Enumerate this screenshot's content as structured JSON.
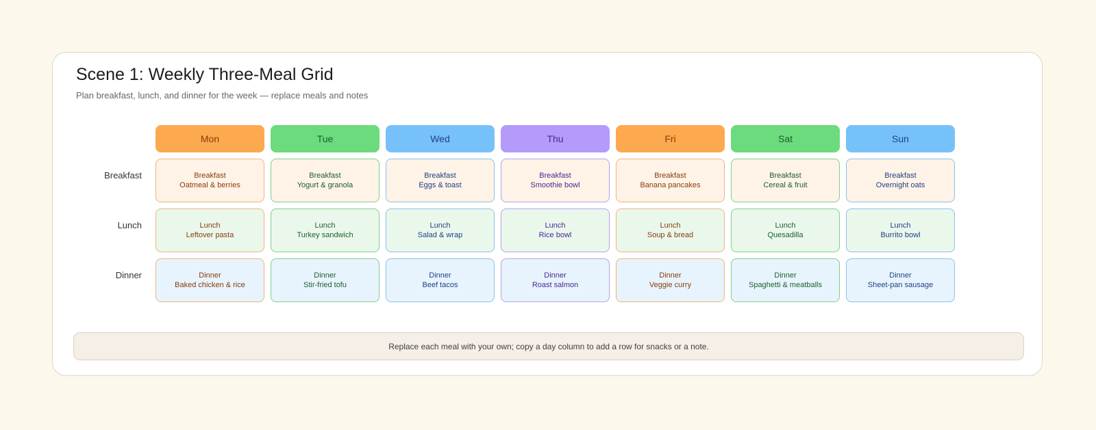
{
  "title": "Scene 1: Weekly Three-Meal Grid",
  "subtitle": "Plan breakfast, lunch, and dinner for the week — replace meals and notes",
  "days": [
    {
      "label": "Mon",
      "color": "#fda94f",
      "text_color": "#8a3a0c",
      "border": "#f0b47a"
    },
    {
      "label": "Tue",
      "color": "#6bdb7e",
      "text_color": "#1d5e2c",
      "border": "#7fcf8b"
    },
    {
      "label": "Wed",
      "color": "#77c1fb",
      "text_color": "#1f3f86",
      "border": "#8cbfe8"
    },
    {
      "label": "Thu",
      "color": "#b39afb",
      "text_color": "#4a2596",
      "border": "#b3a2ea"
    },
    {
      "label": "Fri",
      "color": "#fda94f",
      "text_color": "#8a3a0c",
      "border": "#f0b47a"
    },
    {
      "label": "Sat",
      "color": "#6bdb7e",
      "text_color": "#1d5e2c",
      "border": "#7fcf8b"
    },
    {
      "label": "Sun",
      "color": "#77c1fb",
      "text_color": "#1f3f86",
      "border": "#8cbfe8"
    }
  ],
  "rows": [
    {
      "label": "Breakfast",
      "bg": "#fef3e6",
      "meals": [
        "Oatmeal & berries",
        "Yogurt & granola",
        "Eggs & toast",
        "Smoothie bowl",
        "Banana pancakes",
        "Cereal & fruit",
        "Overnight oats"
      ]
    },
    {
      "label": "Lunch",
      "bg": "#eaf8ec",
      "meals": [
        "Leftover pasta",
        "Turkey sandwich",
        "Salad & wrap",
        "Rice bowl",
        "Soup & bread",
        "Quesadilla",
        "Burrito bowl"
      ]
    },
    {
      "label": "Dinner",
      "bg": "#e7f4fd",
      "meals": [
        "Baked chicken & rice",
        "Stir-fried tofu",
        "Beef tacos",
        "Roast salmon",
        "Veggie curry",
        "Spaghetti & meatballs",
        "Sheet-pan sausage"
      ]
    }
  ],
  "footer_note": "Replace each meal with your own; copy a day column to add a row for snacks or a note."
}
